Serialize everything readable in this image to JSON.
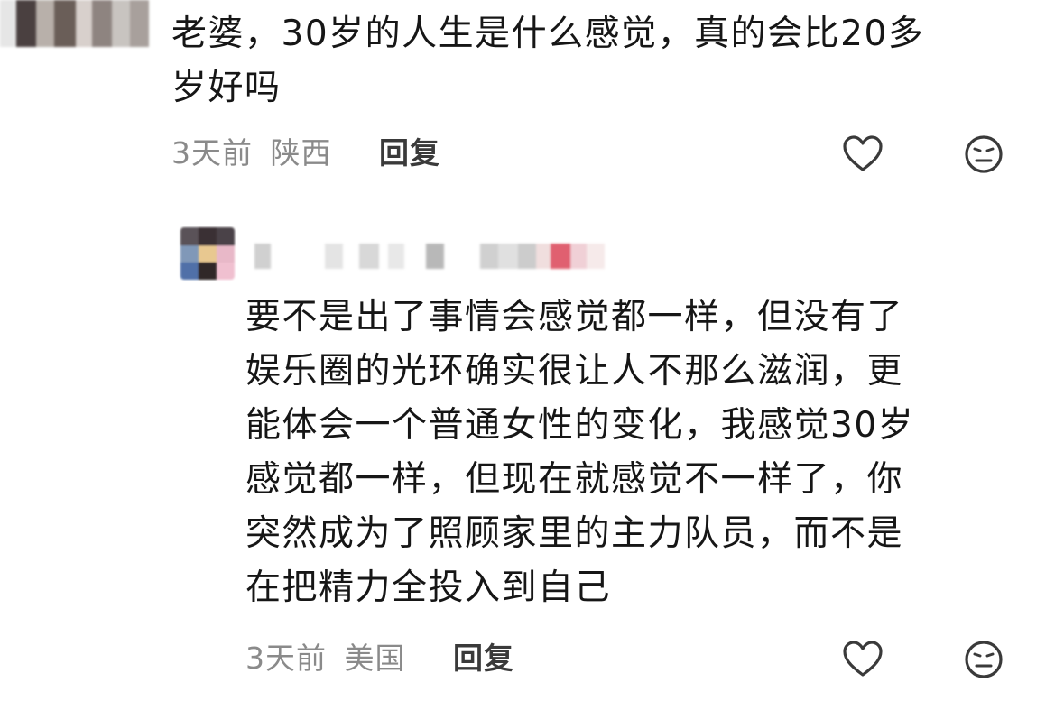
{
  "comment": {
    "text_line1": "老婆，30岁的人生是什么感觉，真的会比20多",
    "text_line2": "岁好吗",
    "time": "3天前",
    "location": "陕西",
    "reply_label": "回复",
    "icons": [
      "heart-icon",
      "neutral-face-icon"
    ]
  },
  "reply_comment": {
    "lines": [
      "要不是出了事情会感觉都一样，但没有了",
      "娱乐圈的光环确实很让人不那么滋润，更",
      "能体会一个普通女性的变化，我感觉30岁",
      "感觉都一样，但现在就感觉不一样了，你",
      "突然成为了照顾家里的主力队员，而不是",
      "在把精力全投入到自己"
    ],
    "time": "3天前",
    "location": "美国",
    "reply_label": "回复",
    "icons": [
      "heart-icon",
      "neutral-face-icon"
    ]
  }
}
